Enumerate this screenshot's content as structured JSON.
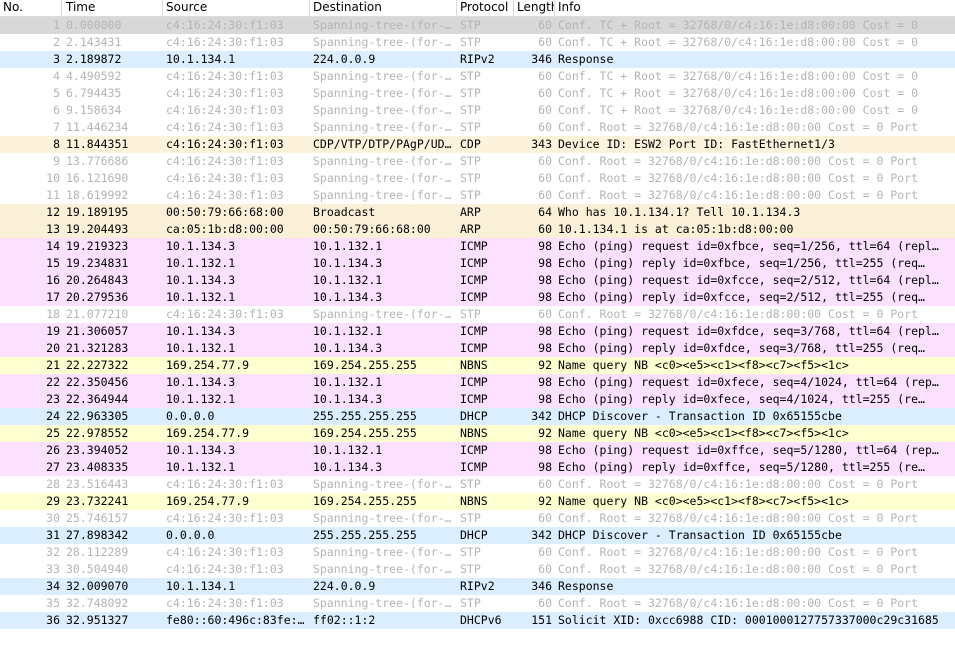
{
  "columns": {
    "no": "No.",
    "time": "Time",
    "source": "Source",
    "destination": "Destination",
    "protocol": "Protocol",
    "length": "Length",
    "info": "Info"
  },
  "packets": [
    {
      "no": "1",
      "time": "0.000000",
      "src": "c4:16:24:30:f1:03",
      "dst": "Spanning-tree-(for-…",
      "proto": "STP",
      "len": "60",
      "info": "Conf. TC + Root = 32768/0/c4:16:1e:d8:00:00  Cost = 0",
      "kind": "stp"
    },
    {
      "no": "2",
      "time": "2.143431",
      "src": "c4:16:24:30:f1:03",
      "dst": "Spanning-tree-(for-…",
      "proto": "STP",
      "len": "60",
      "info": "Conf. TC + Root = 32768/0/c4:16:1e:d8:00:00  Cost = 0",
      "kind": "stp"
    },
    {
      "no": "3",
      "time": "2.189872",
      "src": "10.1.134.1",
      "dst": "224.0.0.9",
      "proto": "RIPv2",
      "len": "346",
      "info": "Response",
      "kind": "rip"
    },
    {
      "no": "4",
      "time": "4.490592",
      "src": "c4:16:24:30:f1:03",
      "dst": "Spanning-tree-(for-…",
      "proto": "STP",
      "len": "60",
      "info": "Conf. TC + Root = 32768/0/c4:16:1e:d8:00:00  Cost = 0",
      "kind": "stp"
    },
    {
      "no": "5",
      "time": "6.794435",
      "src": "c4:16:24:30:f1:03",
      "dst": "Spanning-tree-(for-…",
      "proto": "STP",
      "len": "60",
      "info": "Conf. TC + Root = 32768/0/c4:16:1e:d8:00:00  Cost = 0",
      "kind": "stp"
    },
    {
      "no": "6",
      "time": "9.158634",
      "src": "c4:16:24:30:f1:03",
      "dst": "Spanning-tree-(for-…",
      "proto": "STP",
      "len": "60",
      "info": "Conf. TC + Root = 32768/0/c4:16:1e:d8:00:00  Cost = 0",
      "kind": "stp"
    },
    {
      "no": "7",
      "time": "11.446234",
      "src": "c4:16:24:30:f1:03",
      "dst": "Spanning-tree-(for-…",
      "proto": "STP",
      "len": "60",
      "info": "Conf. Root = 32768/0/c4:16:1e:d8:00:00  Cost = 0  Port",
      "kind": "stp"
    },
    {
      "no": "8",
      "time": "11.844351",
      "src": "c4:16:24:30:f1:03",
      "dst": "CDP/VTP/DTP/PAgP/UD…",
      "proto": "CDP",
      "len": "343",
      "info": "Device ID: ESW2  Port ID: FastEthernet1/3",
      "kind": "cdp"
    },
    {
      "no": "9",
      "time": "13.776686",
      "src": "c4:16:24:30:f1:03",
      "dst": "Spanning-tree-(for-…",
      "proto": "STP",
      "len": "60",
      "info": "Conf. Root = 32768/0/c4:16:1e:d8:00:00  Cost = 0  Port",
      "kind": "stp"
    },
    {
      "no": "10",
      "time": "16.121690",
      "src": "c4:16:24:30:f1:03",
      "dst": "Spanning-tree-(for-…",
      "proto": "STP",
      "len": "60",
      "info": "Conf. Root = 32768/0/c4:16:1e:d8:00:00  Cost = 0  Port",
      "kind": "stp"
    },
    {
      "no": "11",
      "time": "18.619992",
      "src": "c4:16:24:30:f1:03",
      "dst": "Spanning-tree-(for-…",
      "proto": "STP",
      "len": "60",
      "info": "Conf. Root = 32768/0/c4:16:1e:d8:00:00  Cost = 0  Port",
      "kind": "stp"
    },
    {
      "no": "12",
      "time": "19.189195",
      "src": "00:50:79:66:68:00",
      "dst": "Broadcast",
      "proto": "ARP",
      "len": "64",
      "info": "Who has 10.1.134.1? Tell 10.1.134.3",
      "kind": "arp"
    },
    {
      "no": "13",
      "time": "19.204493",
      "src": "ca:05:1b:d8:00:00",
      "dst": "00:50:79:66:68:00",
      "proto": "ARP",
      "len": "60",
      "info": "10.1.134.1 is at ca:05:1b:d8:00:00",
      "kind": "arp"
    },
    {
      "no": "14",
      "time": "19.219323",
      "src": "10.1.134.3",
      "dst": "10.1.132.1",
      "proto": "ICMP",
      "len": "98",
      "info": "Echo (ping) request  id=0xfbce, seq=1/256, ttl=64 (repl…",
      "kind": "icmp"
    },
    {
      "no": "15",
      "time": "19.234831",
      "src": "10.1.132.1",
      "dst": "10.1.134.3",
      "proto": "ICMP",
      "len": "98",
      "info": "Echo (ping) reply    id=0xfbce, seq=1/256, ttl=255 (req…",
      "kind": "icmp"
    },
    {
      "no": "16",
      "time": "20.264843",
      "src": "10.1.134.3",
      "dst": "10.1.132.1",
      "proto": "ICMP",
      "len": "98",
      "info": "Echo (ping) request  id=0xfcce, seq=2/512, ttl=64 (repl…",
      "kind": "icmp"
    },
    {
      "no": "17",
      "time": "20.279536",
      "src": "10.1.132.1",
      "dst": "10.1.134.3",
      "proto": "ICMP",
      "len": "98",
      "info": "Echo (ping) reply    id=0xfcce, seq=2/512, ttl=255 (req…",
      "kind": "icmp"
    },
    {
      "no": "18",
      "time": "21.077210",
      "src": "c4:16:24:30:f1:03",
      "dst": "Spanning-tree-(for-…",
      "proto": "STP",
      "len": "60",
      "info": "Conf. Root = 32768/0/c4:16:1e:d8:00:00  Cost = 0  Port",
      "kind": "stp"
    },
    {
      "no": "19",
      "time": "21.306057",
      "src": "10.1.134.3",
      "dst": "10.1.132.1",
      "proto": "ICMP",
      "len": "98",
      "info": "Echo (ping) request  id=0xfdce, seq=3/768, ttl=64 (repl…",
      "kind": "icmp"
    },
    {
      "no": "20",
      "time": "21.321283",
      "src": "10.1.132.1",
      "dst": "10.1.134.3",
      "proto": "ICMP",
      "len": "98",
      "info": "Echo (ping) reply    id=0xfdce, seq=3/768, ttl=255 (req…",
      "kind": "icmp"
    },
    {
      "no": "21",
      "time": "22.227322",
      "src": "169.254.77.9",
      "dst": "169.254.255.255",
      "proto": "NBNS",
      "len": "92",
      "info": "Name query NB <c0><e5><c1><f8><c7><f5><1c>",
      "kind": "nbns"
    },
    {
      "no": "22",
      "time": "22.350456",
      "src": "10.1.134.3",
      "dst": "10.1.132.1",
      "proto": "ICMP",
      "len": "98",
      "info": "Echo (ping) request  id=0xfece, seq=4/1024, ttl=64 (rep…",
      "kind": "icmp"
    },
    {
      "no": "23",
      "time": "22.364944",
      "src": "10.1.132.1",
      "dst": "10.1.134.3",
      "proto": "ICMP",
      "len": "98",
      "info": "Echo (ping) reply    id=0xfece, seq=4/1024, ttl=255 (re…",
      "kind": "icmp"
    },
    {
      "no": "24",
      "time": "22.963305",
      "src": "0.0.0.0",
      "dst": "255.255.255.255",
      "proto": "DHCP",
      "len": "342",
      "info": "DHCP Discover - Transaction ID 0x65155cbe",
      "kind": "dhcp"
    },
    {
      "no": "25",
      "time": "22.978552",
      "src": "169.254.77.9",
      "dst": "169.254.255.255",
      "proto": "NBNS",
      "len": "92",
      "info": "Name query NB <c0><e5><c1><f8><c7><f5><1c>",
      "kind": "nbns"
    },
    {
      "no": "26",
      "time": "23.394052",
      "src": "10.1.134.3",
      "dst": "10.1.132.1",
      "proto": "ICMP",
      "len": "98",
      "info": "Echo (ping) request  id=0xffce, seq=5/1280, ttl=64 (rep…",
      "kind": "icmp"
    },
    {
      "no": "27",
      "time": "23.408335",
      "src": "10.1.132.1",
      "dst": "10.1.134.3",
      "proto": "ICMP",
      "len": "98",
      "info": "Echo (ping) reply    id=0xffce, seq=5/1280, ttl=255 (re…",
      "kind": "icmp"
    },
    {
      "no": "28",
      "time": "23.516443",
      "src": "c4:16:24:30:f1:03",
      "dst": "Spanning-tree-(for-…",
      "proto": "STP",
      "len": "60",
      "info": "Conf. Root = 32768/0/c4:16:1e:d8:00:00  Cost = 0  Port",
      "kind": "stp"
    },
    {
      "no": "29",
      "time": "23.732241",
      "src": "169.254.77.9",
      "dst": "169.254.255.255",
      "proto": "NBNS",
      "len": "92",
      "info": "Name query NB <c0><e5><c1><f8><c7><f5><1c>",
      "kind": "nbns"
    },
    {
      "no": "30",
      "time": "25.746157",
      "src": "c4:16:24:30:f1:03",
      "dst": "Spanning-tree-(for-…",
      "proto": "STP",
      "len": "60",
      "info": "Conf. Root = 32768/0/c4:16:1e:d8:00:00  Cost = 0  Port",
      "kind": "stp"
    },
    {
      "no": "31",
      "time": "27.898342",
      "src": "0.0.0.0",
      "dst": "255.255.255.255",
      "proto": "DHCP",
      "len": "342",
      "info": "DHCP Discover - Transaction ID 0x65155cbe",
      "kind": "dhcp"
    },
    {
      "no": "32",
      "time": "28.112289",
      "src": "c4:16:24:30:f1:03",
      "dst": "Spanning-tree-(for-…",
      "proto": "STP",
      "len": "60",
      "info": "Conf. Root = 32768/0/c4:16:1e:d8:00:00  Cost = 0  Port",
      "kind": "stp"
    },
    {
      "no": "33",
      "time": "30.504940",
      "src": "c4:16:24:30:f1:03",
      "dst": "Spanning-tree-(for-…",
      "proto": "STP",
      "len": "60",
      "info": "Conf. Root = 32768/0/c4:16:1e:d8:00:00  Cost = 0  Port",
      "kind": "stp"
    },
    {
      "no": "34",
      "time": "32.009070",
      "src": "10.1.134.1",
      "dst": "224.0.0.9",
      "proto": "RIPv2",
      "len": "346",
      "info": "Response",
      "kind": "rip"
    },
    {
      "no": "35",
      "time": "32.748092",
      "src": "c4:16:24:30:f1:03",
      "dst": "Spanning-tree-(for-…",
      "proto": "STP",
      "len": "60",
      "info": "Conf. Root = 32768/0/c4:16:1e:d8:00:00  Cost = 0  Port",
      "kind": "stp"
    },
    {
      "no": "36",
      "time": "32.951327",
      "src": "fe80::60:496c:83fe:…",
      "dst": "ff02::1:2",
      "proto": "DHCPv6",
      "len": "151",
      "info": "Solicit XID: 0xcc6988 CID: 0001000127757337000c29c31685",
      "kind": "dhcp"
    }
  ]
}
